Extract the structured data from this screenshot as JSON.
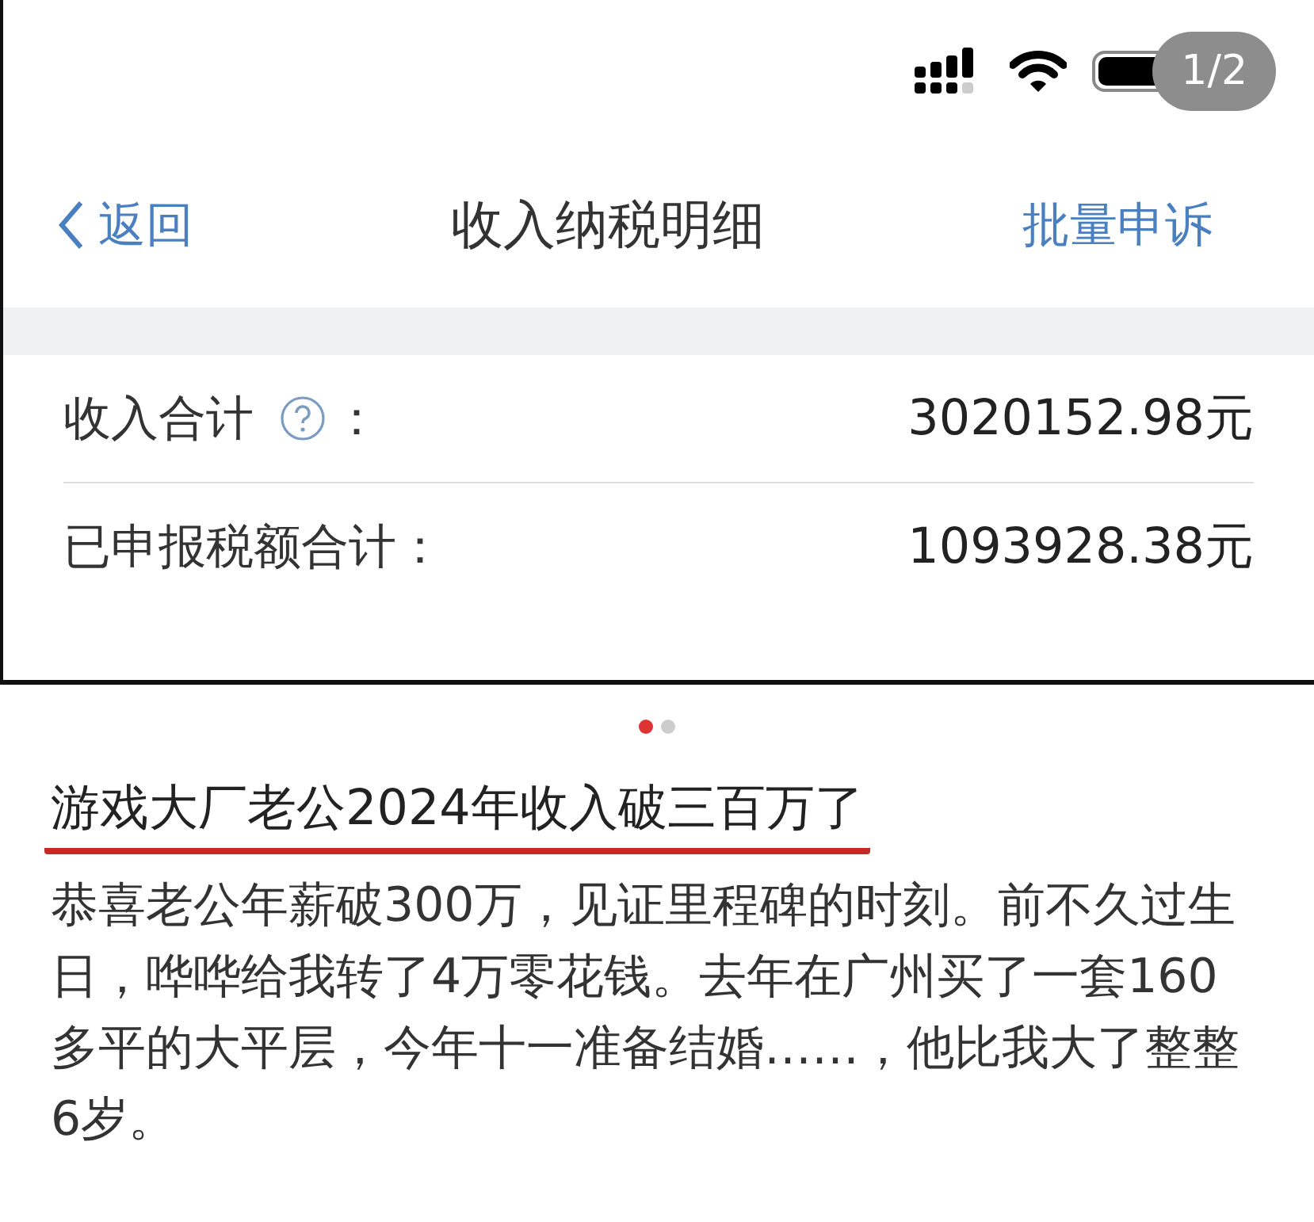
{
  "status_bar": {
    "page_badge": "1/2"
  },
  "nav": {
    "back": "返回",
    "title": "收入纳税明细",
    "action": "批量申诉"
  },
  "rows": [
    {
      "label": "收入合计",
      "help": true,
      "suffix": "：",
      "value": "3020152.98元"
    },
    {
      "label": "已申报税额合计：",
      "help": false,
      "value": "1093928.38元"
    }
  ],
  "carousel_dots": [
    {
      "selected": true
    },
    {
      "selected": false
    }
  ],
  "post": {
    "title": "游戏大厂老公2024年收入破三百万了",
    "body": "恭喜老公年薪破300万，见证里程碑的时刻。前不久过生日，哗哗给我转了4万零花钱。去年在广州买了一套160多平的大平层，今年十一准备结婚……，他比我大了整整6岁。"
  }
}
